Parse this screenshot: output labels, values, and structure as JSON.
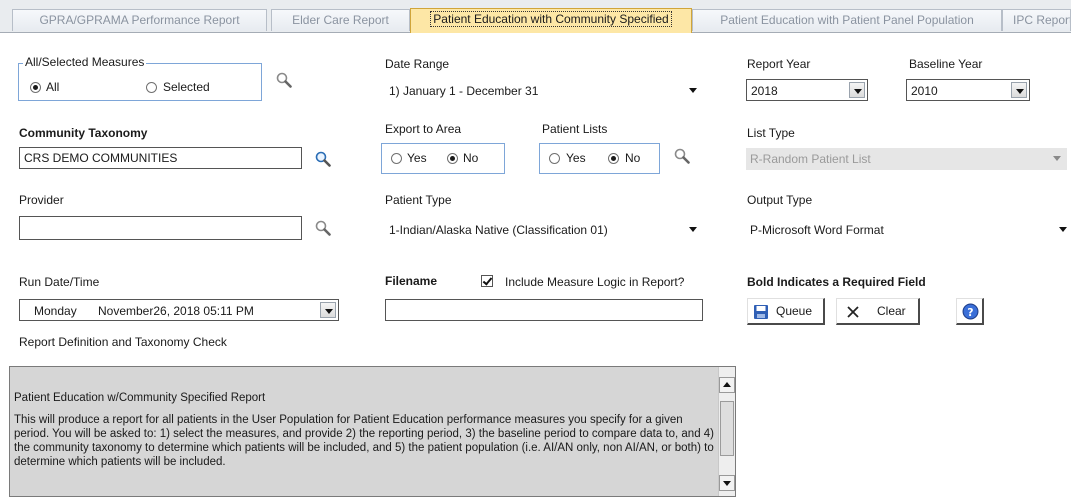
{
  "tabs": [
    {
      "label": "GPRA/GPRAMA Performance Report",
      "active": false
    },
    {
      "label": "Elder Care Report",
      "active": false
    },
    {
      "label": "Patient Education with Community Specified",
      "active": true
    },
    {
      "label": "Patient Education with Patient Panel Population",
      "active": false
    },
    {
      "label": "IPC Report",
      "active": false
    }
  ],
  "measures": {
    "group_label": "All/Selected Measures",
    "all_label": "All",
    "selected_label": "Selected",
    "selected_value": "All"
  },
  "date_range": {
    "label": "Date Range",
    "value": "1) January 1 - December 31"
  },
  "report_year": {
    "label": "Report Year",
    "value": "2018"
  },
  "baseline_year": {
    "label": "Baseline Year",
    "value": "2010"
  },
  "community_taxonomy": {
    "label": "Community Taxonomy",
    "value": "CRS DEMO COMMUNITIES"
  },
  "export_to_area": {
    "label": "Export to Area",
    "yes_label": "Yes",
    "no_label": "No",
    "selected_value": "No"
  },
  "patient_lists": {
    "label": "Patient Lists",
    "yes_label": "Yes",
    "no_label": "No",
    "selected_value": "No"
  },
  "list_type": {
    "label": "List Type",
    "value": "R-Random Patient List",
    "disabled": true
  },
  "provider": {
    "label": "Provider",
    "value": ""
  },
  "patient_type": {
    "label": "Patient Type",
    "value": "1-Indian/Alaska Native (Classification 01)"
  },
  "output_type": {
    "label": "Output Type",
    "value": "P-Microsoft Word Format"
  },
  "run_datetime": {
    "label": "Run Date/Time",
    "day": "Monday",
    "value": "November26, 2018  05:11 PM"
  },
  "filename": {
    "label": "Filename",
    "value": "",
    "include_logic_label": "Include Measure Logic in Report?",
    "include_logic_checked": true
  },
  "required_note": "Bold Indicates a Required Field",
  "buttons": {
    "queue": "Queue",
    "clear": "Clear"
  },
  "definition": {
    "label": "Report Definition and Taxonomy Check",
    "title": "Patient Education w/Community Specified Report",
    "body": "This will produce a report for all patients in the User Population for Patient Education performance measures you specify for a given period.  You will be asked to:  1) select the measures, and provide 2) the reporting period, 3) the baseline period to compare data to, and 4) the community taxonomy to determine which patients will be included, and 5) the patient population (i.e. AI/AN only, non AI/AN, or both) to determine which patients will be included."
  },
  "colors": {
    "active_tab": "#fde7a6",
    "group_border": "#7ea6d8",
    "memo_background": "#d6d6d6",
    "save_icon": "#2f5fb5",
    "help_icon": "#3a6fd8"
  }
}
